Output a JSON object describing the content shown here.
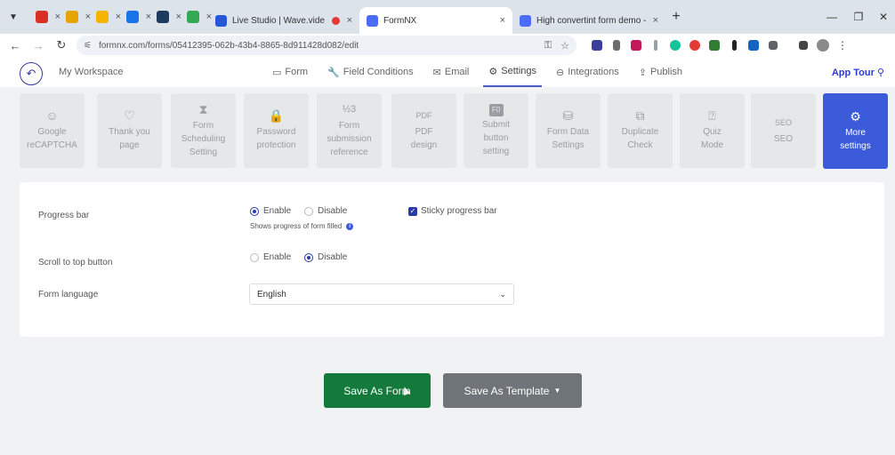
{
  "browser": {
    "tabs": [
      {
        "title": "Live Studio | Wave.video",
        "color": "#2456d6"
      },
      {
        "title": "FormNX",
        "color": "#4a6cf7",
        "active": true
      },
      {
        "title": "High convertint form demo - Fo",
        "color": "#4a6cf7"
      }
    ],
    "mini_tabs": [
      {
        "icon": "gmail-icon",
        "color": "#d93025"
      },
      {
        "icon": "pen-icon",
        "color": "#e6a400"
      },
      {
        "icon": "folder-icon",
        "color": "#f4b400"
      },
      {
        "icon": "arrow-app-icon",
        "color": "#1a73e8"
      },
      {
        "icon": "s-app-icon",
        "color": "#1f3a5f"
      },
      {
        "icon": "brush-icon",
        "color": "#34a853"
      }
    ],
    "url": "formnx.com/forms/05412395-062b-43b4-8865-8d911428d082/edit"
  },
  "appbar": {
    "workspace": "My Workspace",
    "nav": [
      {
        "label": "Form",
        "icon": "▭"
      },
      {
        "label": "Field Conditions",
        "icon": "🔧"
      },
      {
        "label": "Email",
        "icon": "✉"
      },
      {
        "label": "Settings",
        "icon": "⚙",
        "active": true
      },
      {
        "label": "Integrations",
        "icon": "⊖"
      },
      {
        "label": "Publish",
        "icon": "⇪"
      }
    ],
    "app_tour": "App Tour"
  },
  "cards": [
    {
      "line1": "Google",
      "line2": "reCAPTCHA",
      "icon": "bot-icon",
      "glyph": "☺"
    },
    {
      "line1": "Thank you",
      "line2": "page",
      "icon": "heart-icon",
      "glyph": "♡"
    },
    {
      "line1": "Form",
      "line2": "Scheduling",
      "line3": "Setting",
      "icon": "hourglass-icon",
      "glyph": "⧗"
    },
    {
      "line1": "Password",
      "line2": "protection",
      "icon": "lock-icon",
      "glyph": "🔒"
    },
    {
      "line1": "Form",
      "line2": "submission",
      "line3": "reference",
      "icon": "numbering-icon",
      "glyph": "½3"
    },
    {
      "line1": "PDF",
      "line2": "design",
      "icon": "pdf-icon",
      "glyph": "PDF"
    },
    {
      "line1": "Submit",
      "line2": "button",
      "line3": "setting",
      "icon": "submit-icon",
      "glyph": "F0"
    },
    {
      "line1": "Form Data",
      "line2": "Settings",
      "icon": "database-icon",
      "glyph": "⛁"
    },
    {
      "line1": "Duplicate",
      "line2": "Check",
      "icon": "duplicate-icon",
      "glyph": "⧉"
    },
    {
      "line1": "Quiz",
      "line2": "Mode",
      "icon": "quiz-icon",
      "glyph": "⍰"
    },
    {
      "line1": "SEO",
      "line2": "",
      "icon": "seo-icon",
      "glyph": "SEO"
    },
    {
      "line1": "More",
      "line2": "settings",
      "icon": "gear-icon",
      "glyph": "⚙",
      "active": true
    }
  ],
  "settings": {
    "progress_bar": {
      "label": "Progress bar",
      "enable": "Enable",
      "disable": "Disable",
      "selected": "Enable",
      "hint": "Shows progress of form filled",
      "sticky_label": "Sticky progress bar",
      "sticky_checked": true
    },
    "scroll_top": {
      "label": "Scroll to top button",
      "enable": "Enable",
      "disable": "Disable",
      "selected": "Disable"
    },
    "language": {
      "label": "Form language",
      "value": "English"
    }
  },
  "buttons": {
    "save_form": "Save As Form",
    "save_template": "Save As Template"
  },
  "colors": {
    "accent": "#3b5bdb",
    "save": "#137a3c",
    "template": "#6e7478"
  }
}
